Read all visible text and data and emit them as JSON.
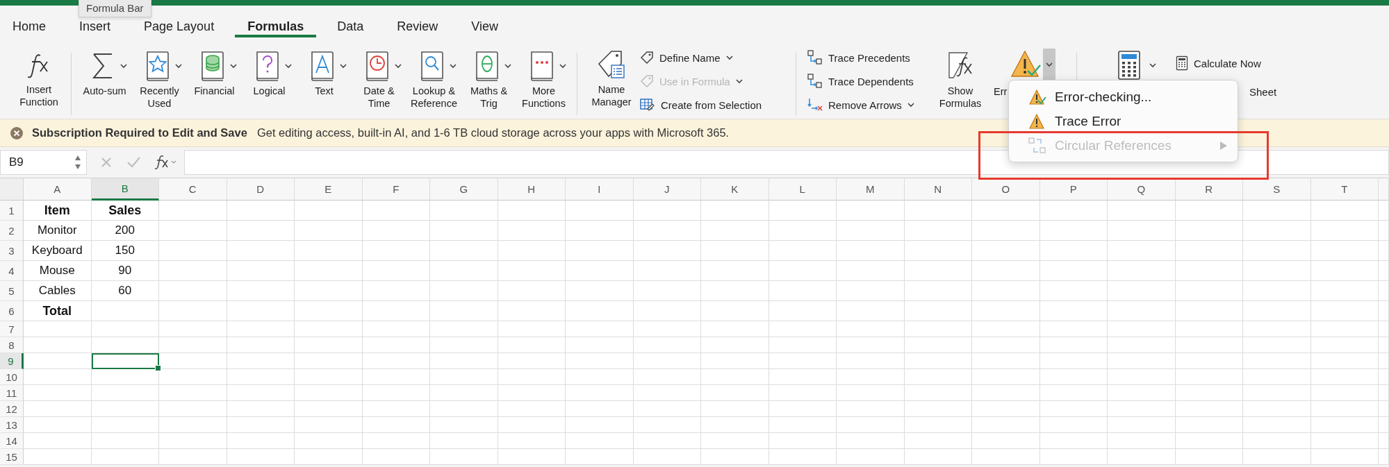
{
  "tooltip": {
    "text": "Formula Bar"
  },
  "tabs": [
    {
      "label": "Home",
      "selected": false
    },
    {
      "label": "Insert",
      "selected": false
    },
    {
      "label": "Page Layout",
      "selected": false
    },
    {
      "label": "Formulas",
      "selected": true
    },
    {
      "label": "Data",
      "selected": false
    },
    {
      "label": "Review",
      "selected": false
    },
    {
      "label": "View",
      "selected": false
    }
  ],
  "ribbon": {
    "insert_function": {
      "lines": [
        "Insert",
        "Function"
      ]
    },
    "library": [
      {
        "kind": "sum",
        "lines": [
          "Auto-sum"
        ]
      },
      {
        "kind": "star",
        "lines": [
          "Recently",
          "Used"
        ]
      },
      {
        "kind": "coins",
        "lines": [
          "Financial"
        ]
      },
      {
        "kind": "question",
        "lines": [
          "Logical"
        ]
      },
      {
        "kind": "letter",
        "lines": [
          "Text"
        ]
      },
      {
        "kind": "clock",
        "lines": [
          "Date &",
          "Time"
        ]
      },
      {
        "kind": "magnifier",
        "lines": [
          "Lookup &",
          "Reference"
        ]
      },
      {
        "kind": "theta",
        "lines": [
          "Maths &",
          "Trig"
        ]
      },
      {
        "kind": "dots",
        "lines": [
          "More",
          "Functions"
        ]
      }
    ],
    "name_manager": {
      "lines": [
        "Name",
        "Manager"
      ]
    },
    "names": [
      {
        "kind": "tag",
        "label": "Define Name",
        "disabled": false,
        "has_menu": true
      },
      {
        "kind": "tag-fx",
        "label": "Use in Formula",
        "disabled": true,
        "has_menu": true
      },
      {
        "kind": "table",
        "label": "Create from Selection",
        "disabled": false,
        "has_menu": false
      }
    ],
    "auditing": [
      {
        "kind": "precedents",
        "label": "Trace Precedents",
        "has_menu": false
      },
      {
        "kind": "dependents",
        "label": "Trace Dependents",
        "has_menu": false
      },
      {
        "kind": "remove",
        "label": "Remove Arrows",
        "has_menu": true
      }
    ],
    "show_formulas": {
      "lines": [
        "Show",
        "Formulas"
      ]
    },
    "error_checking": {
      "label": "Err",
      "open": true
    },
    "calculate_now": {
      "label": "Calculate Now"
    },
    "calculate_sheet": {
      "label": "Sheet"
    }
  },
  "menu": [
    {
      "kind": "check",
      "label": "Error-checking...",
      "disabled": false,
      "submenu": false
    },
    {
      "kind": "warning",
      "label": "Trace Error",
      "disabled": false,
      "submenu": false
    },
    {
      "kind": "circular",
      "label": "Circular References",
      "disabled": true,
      "submenu": true
    }
  ],
  "highlight_frame": true,
  "banner": {
    "title": "Subscription Required to Edit and Save",
    "message": "Get editing access, built-in AI, and 1-6 TB cloud storage across your apps with Microsoft 365."
  },
  "formula_bar": {
    "name_box": "B9"
  },
  "columns": [
    {
      "label": "A",
      "selected": false
    },
    {
      "label": "B",
      "selected": true
    },
    {
      "label": "C",
      "selected": false
    },
    {
      "label": "D",
      "selected": false
    },
    {
      "label": "E",
      "selected": false
    },
    {
      "label": "F",
      "selected": false
    },
    {
      "label": "G",
      "selected": false
    },
    {
      "label": "H",
      "selected": false
    },
    {
      "label": "I",
      "selected": false
    },
    {
      "label": "J",
      "selected": false
    },
    {
      "label": "K",
      "selected": false
    },
    {
      "label": "L",
      "selected": false
    },
    {
      "label": "M",
      "selected": false
    },
    {
      "label": "N",
      "selected": false
    },
    {
      "label": "O",
      "selected": false
    },
    {
      "label": "P",
      "selected": false
    },
    {
      "label": "Q",
      "selected": false
    },
    {
      "label": "R",
      "selected": false
    },
    {
      "label": "S",
      "selected": false
    },
    {
      "label": "T",
      "selected": false
    }
  ],
  "rows": [
    {
      "number": "1",
      "selected": false,
      "cells": [
        {
          "text": "Item",
          "bold": true
        },
        {
          "text": "Sales",
          "bold": true
        }
      ]
    },
    {
      "number": "2",
      "selected": false,
      "cells": [
        {
          "text": "Monitor",
          "bold": false
        },
        {
          "text": "200",
          "bold": false
        }
      ]
    },
    {
      "number": "3",
      "selected": false,
      "cells": [
        {
          "text": "Keyboard",
          "bold": false
        },
        {
          "text": "150",
          "bold": false
        }
      ]
    },
    {
      "number": "4",
      "selected": false,
      "cells": [
        {
          "text": "Mouse",
          "bold": false
        },
        {
          "text": "90",
          "bold": false
        }
      ]
    },
    {
      "number": "5",
      "selected": false,
      "cells": [
        {
          "text": "Cables",
          "bold": false
        },
        {
          "text": "60",
          "bold": false
        }
      ]
    },
    {
      "number": "6",
      "selected": false,
      "cells": [
        {
          "text": "Total",
          "bold": true
        }
      ]
    },
    {
      "number": "7",
      "selected": false
    },
    {
      "number": "8",
      "selected": false
    },
    {
      "number": "9",
      "selected": true
    },
    {
      "number": "10",
      "selected": false
    },
    {
      "number": "11",
      "selected": false
    },
    {
      "number": "12",
      "selected": false
    },
    {
      "number": "13",
      "selected": false
    },
    {
      "number": "14",
      "selected": false
    },
    {
      "number": "15",
      "selected": false
    }
  ]
}
